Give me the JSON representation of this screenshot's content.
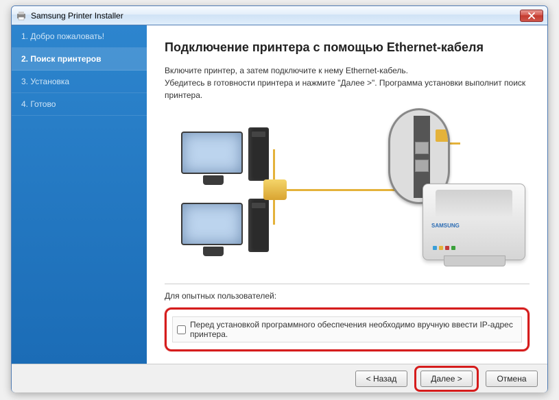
{
  "window": {
    "title": "Samsung Printer Installer"
  },
  "sidebar": {
    "items": [
      {
        "label": "1. Добро пожаловать!"
      },
      {
        "label": "2. Поиск принтеров"
      },
      {
        "label": "3. Установка"
      },
      {
        "label": "4. Готово"
      }
    ],
    "active_index": 1
  },
  "main": {
    "heading": "Подключение принтера с помощью Ethernet-кабеля",
    "desc_line1": "Включите принтер, а затем подключите к нему Ethernet-кабель.",
    "desc_line2": "Убедитесь в готовности принтера и нажмите \"Далее >\". Программа установки выполнит поиск принтера.",
    "printer_brand": "SAMSUNG"
  },
  "advanced": {
    "section_label": "Для опытных пользователей:",
    "checkbox_label": "Перед установкой программного обеспечения необходимо вручную ввести IP-адрес принтера.",
    "checked": false
  },
  "buttons": {
    "back": "< Назад",
    "next": "Далее >",
    "cancel": "Отмена"
  }
}
